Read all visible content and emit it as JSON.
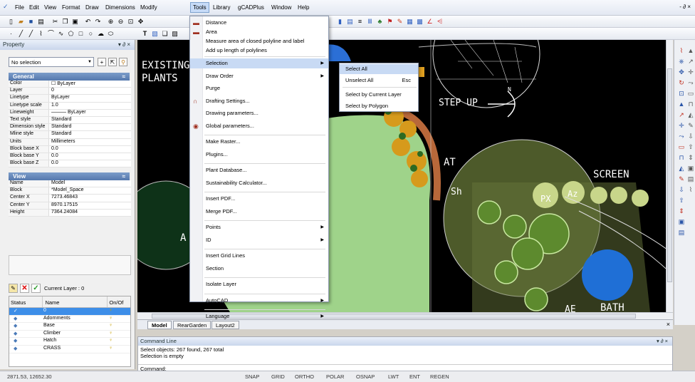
{
  "menubar": {
    "items": [
      "File",
      "Edit",
      "View",
      "Format",
      "Draw",
      "Dimensions",
      "Modify",
      "Tools",
      "Library",
      "gCADPlus",
      "Window",
      "Help"
    ],
    "right": "- ∂ ×"
  },
  "property": {
    "title": "Property",
    "dropdown": "No selection",
    "general": {
      "title": "General",
      "rows": [
        [
          "Color",
          "☐ ByLayer"
        ],
        [
          "Layer",
          "0"
        ],
        [
          "Linetype",
          "ByLayer"
        ],
        [
          "Linetype scale",
          "1.0"
        ],
        [
          "Lineweight",
          "——— ByLayer"
        ],
        [
          "Text style",
          "Standard"
        ],
        [
          "Dimension style",
          "Standard"
        ],
        [
          "Mline style",
          "Standard"
        ],
        [
          "Units",
          "Millimeters"
        ],
        [
          "Block base X",
          "0.0"
        ],
        [
          "Block base Y",
          "0.0"
        ],
        [
          "Block base Z",
          "0.0"
        ]
      ]
    },
    "view": {
      "title": "View",
      "rows": [
        [
          "Name",
          "Model"
        ],
        [
          "Block",
          "*Model_Space"
        ],
        [
          "Center X",
          "7273.46843"
        ],
        [
          "Center Y",
          "8970.17515"
        ],
        [
          "Height",
          "7364.24084"
        ]
      ]
    }
  },
  "layers": {
    "current": "Current Layer : 0",
    "headers": [
      "Status",
      "Name",
      "On/Of"
    ],
    "rows": [
      "0",
      "Adornments",
      "Base",
      "Climber",
      "Hatch",
      "CRASS"
    ]
  },
  "canvas": {
    "labels": [
      "EXISTING",
      "PLANTS",
      "STEP UP",
      "N",
      "AT",
      "Sh",
      "SCREEN",
      "PX",
      "Az",
      "BATH",
      "AE",
      "A"
    ]
  },
  "tools_menu": {
    "items": [
      {
        "label": "Distance",
        "icon": "ruler-icon"
      },
      {
        "label": "Area",
        "icon": "area-icon"
      },
      {
        "label": "Measure area of closed polyline and label"
      },
      {
        "label": "Add up length of polylines"
      },
      {
        "label": "Selection",
        "sub": true
      },
      {
        "label": "Draw Order",
        "sub": true
      },
      {
        "label": "Purge"
      },
      {
        "label": "Drafting Settings...",
        "icon": "magnet-icon"
      },
      {
        "label": "Drawing parameters..."
      },
      {
        "label": "Global parameters...",
        "icon": "globe-icon"
      },
      {
        "label": "Make Raster..."
      },
      {
        "label": "Plugins..."
      },
      {
        "label": "Plant Database..."
      },
      {
        "label": "Sustainability Calculator..."
      },
      {
        "label": "Insert PDF..."
      },
      {
        "label": "Merge PDF..."
      },
      {
        "label": "Points",
        "sub": true
      },
      {
        "label": "ID",
        "sub": true
      },
      {
        "label": "Insert Grid Lines"
      },
      {
        "label": "Section"
      },
      {
        "label": "Isolate Layer"
      },
      {
        "label": "AutoCAD",
        "sub": true
      },
      {
        "label": "Language",
        "sub": true
      }
    ]
  },
  "selection_submenu": {
    "items": [
      {
        "label": "Select All",
        "key": ""
      },
      {
        "label": "Unselect All",
        "key": "Esc"
      },
      {
        "label": "Select by Current Layer",
        "key": ""
      },
      {
        "label": "Select by Polygon",
        "key": ""
      }
    ]
  },
  "tabs": [
    "Model",
    "RearGarden",
    "Layout2"
  ],
  "command": {
    "title": "Command Line",
    "lines": [
      "Select objects: 267 found,  267 total",
      "Selection is empty"
    ],
    "prompt": "Command:",
    "controls": "▾ ∂ ×"
  },
  "status": {
    "coords": "2871.53,  12652.30",
    "toggles": [
      "SNAP",
      "GRID",
      "ORTHO",
      "POLAR",
      "OSNAP",
      "LWT",
      "ENT",
      "REGEN"
    ]
  },
  "colors": {
    "highlight": "#c8daf4",
    "lawn": "#9fd38a",
    "section": "#6388bd"
  }
}
